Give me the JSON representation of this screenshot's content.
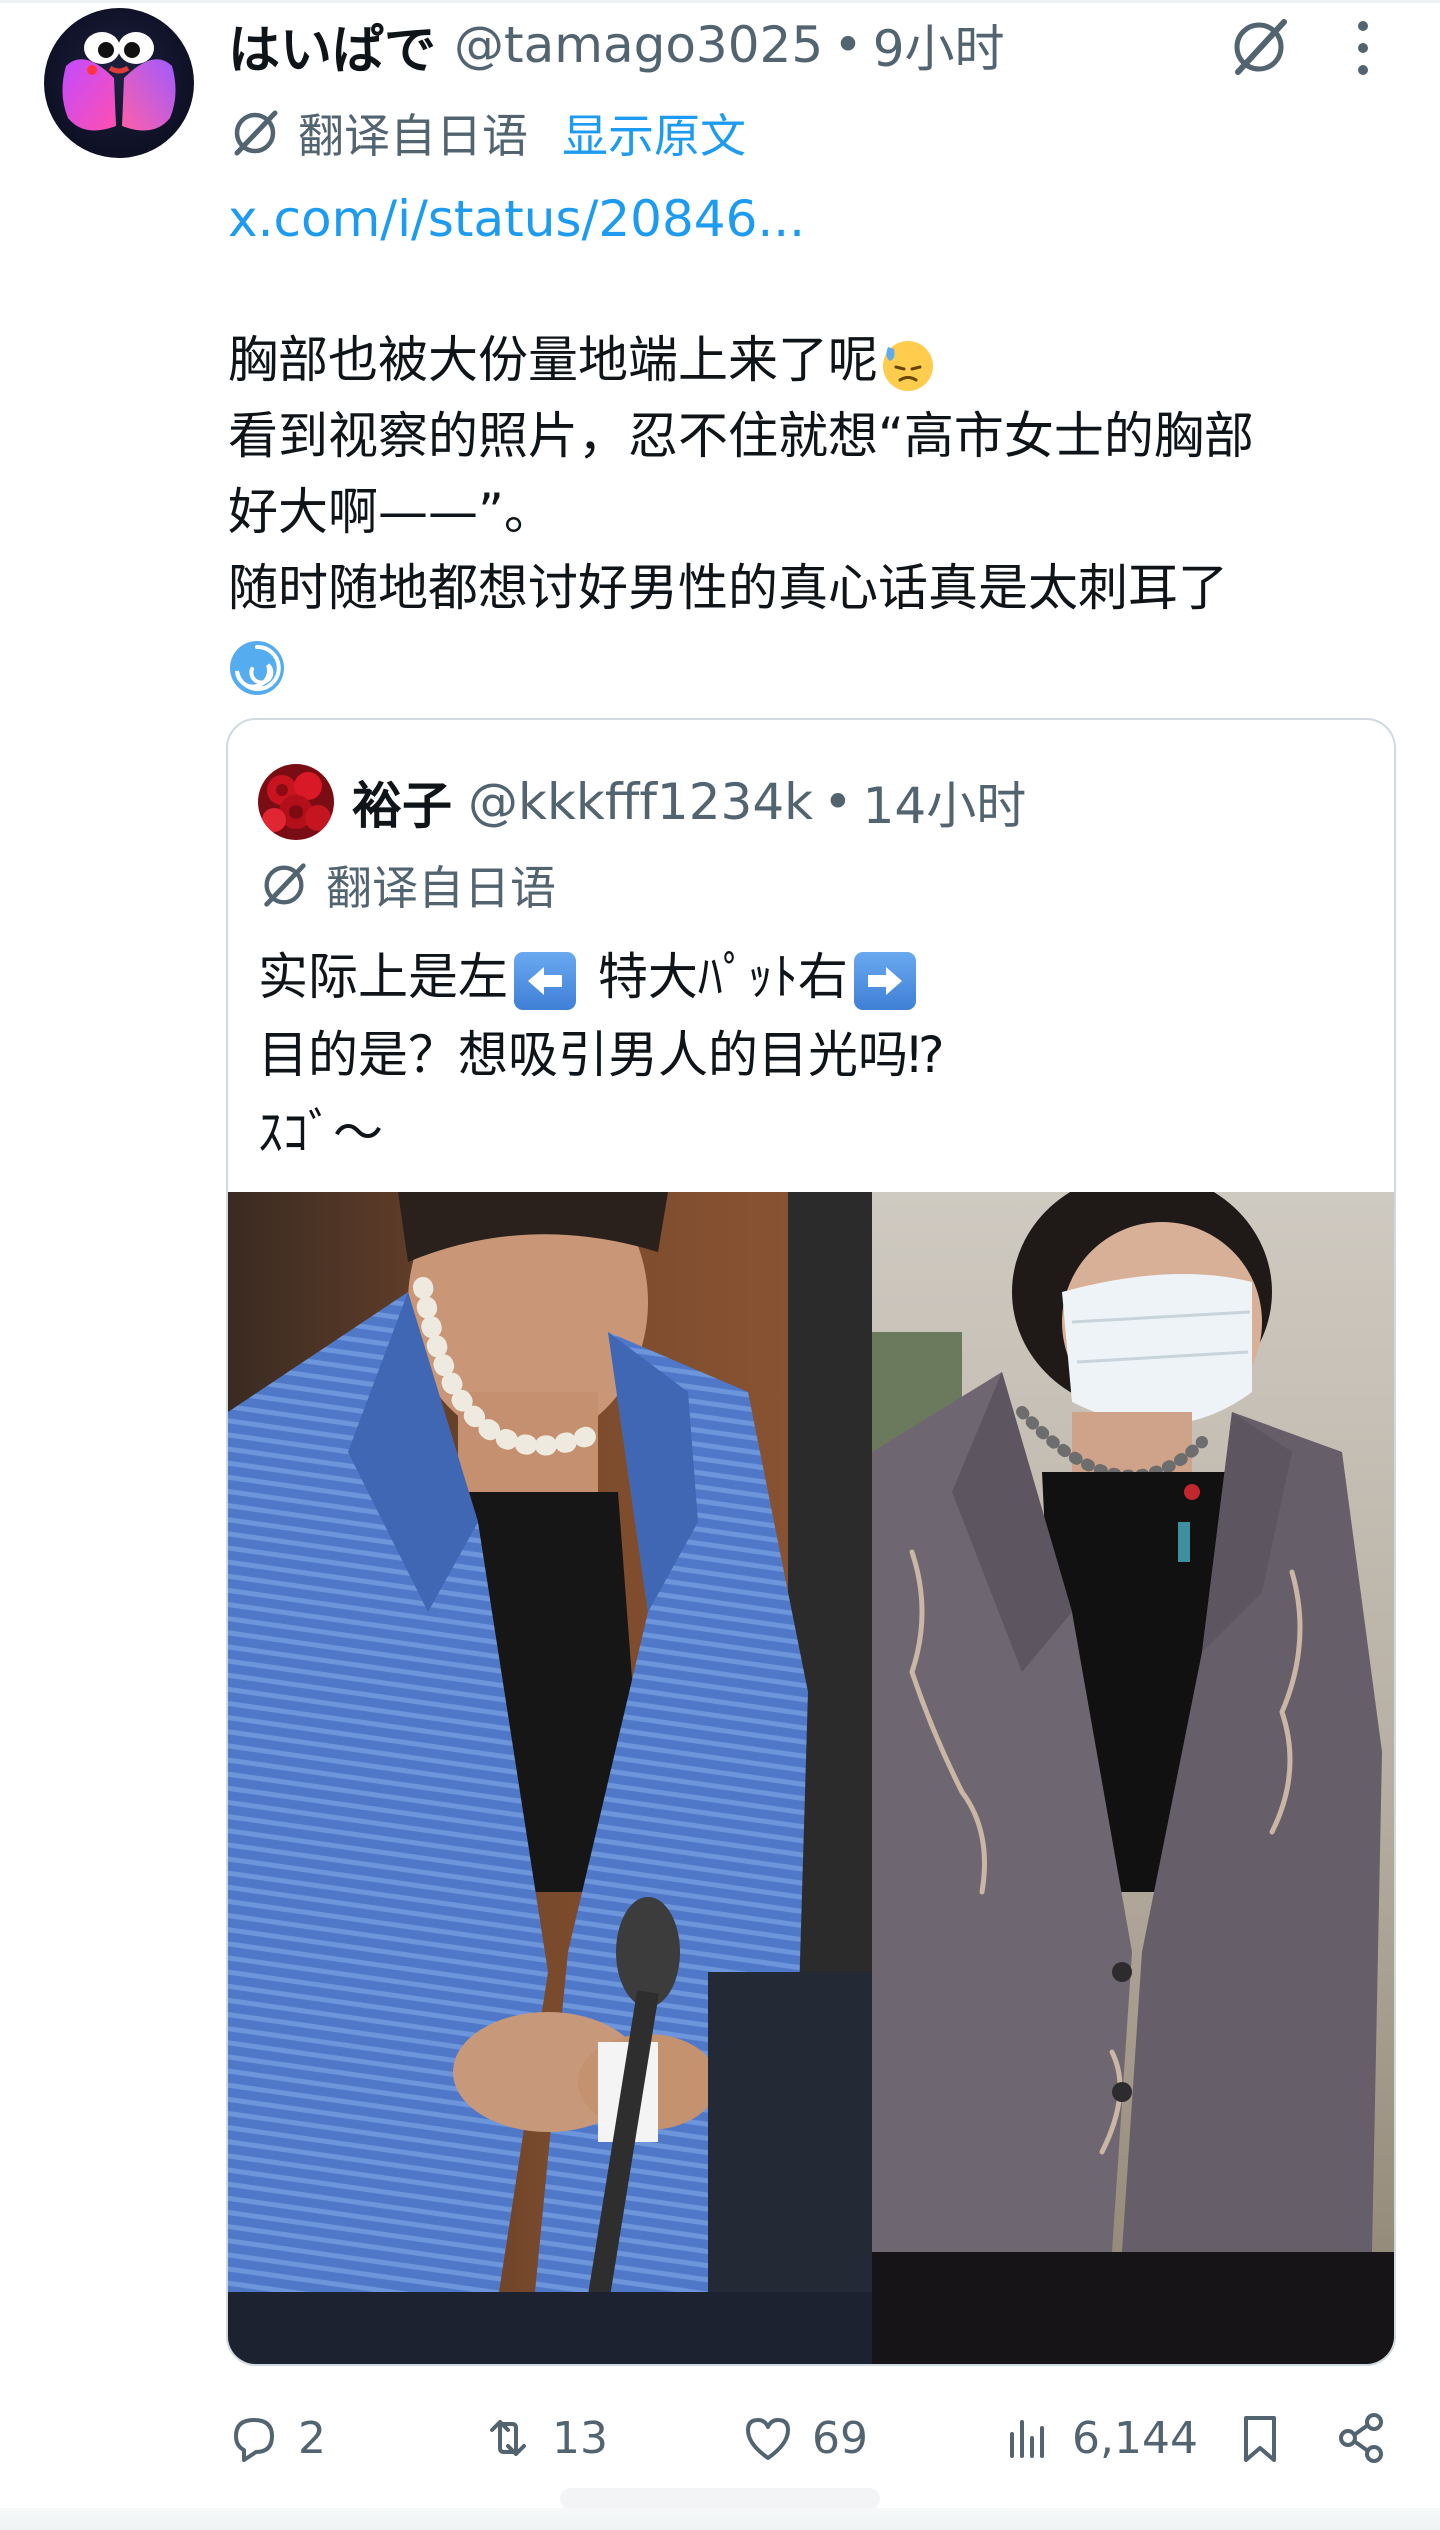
{
  "tweet": {
    "display_name": "はいぱで",
    "handle": "@tamago3025",
    "separator": "•",
    "time": "9小时",
    "translate_label": "翻译自日语",
    "show_original": "显示原文",
    "link": "x.com/i/status/20846...",
    "lines": [
      "胸部也被大份量地端上来了呢",
      "看到视察的照片，忍不住就想“高市女士的胸部",
      "好大啊——”。",
      "随时随地都想讨好男性的真心话真是太刺耳了"
    ],
    "emojis": [
      "sweat-face-emoji",
      "cyclone-emoji"
    ]
  },
  "quote": {
    "display_name": "裕子",
    "handle": "@kkkfff1234k",
    "separator": "•",
    "time": "14小时",
    "translate_label": "翻译自日语",
    "line1_a": "实际上是左",
    "line1_b": "特大ﾊﾟｯﾄ右",
    "line2": "目的是？想吸引男人的目光吗⁉",
    "line3": "ｽｺﾞ～",
    "images": [
      "photo-blue-jacket",
      "photo-gray-jacket-mask"
    ]
  },
  "actions": {
    "reply_count": "2",
    "retweet_count": "13",
    "like_count": "69",
    "views_count": "6,144"
  },
  "colors": {
    "text_primary": "#0f1419",
    "text_secondary": "#536471",
    "link_blue": "#1d9bf0",
    "border": "#cfd9de"
  }
}
